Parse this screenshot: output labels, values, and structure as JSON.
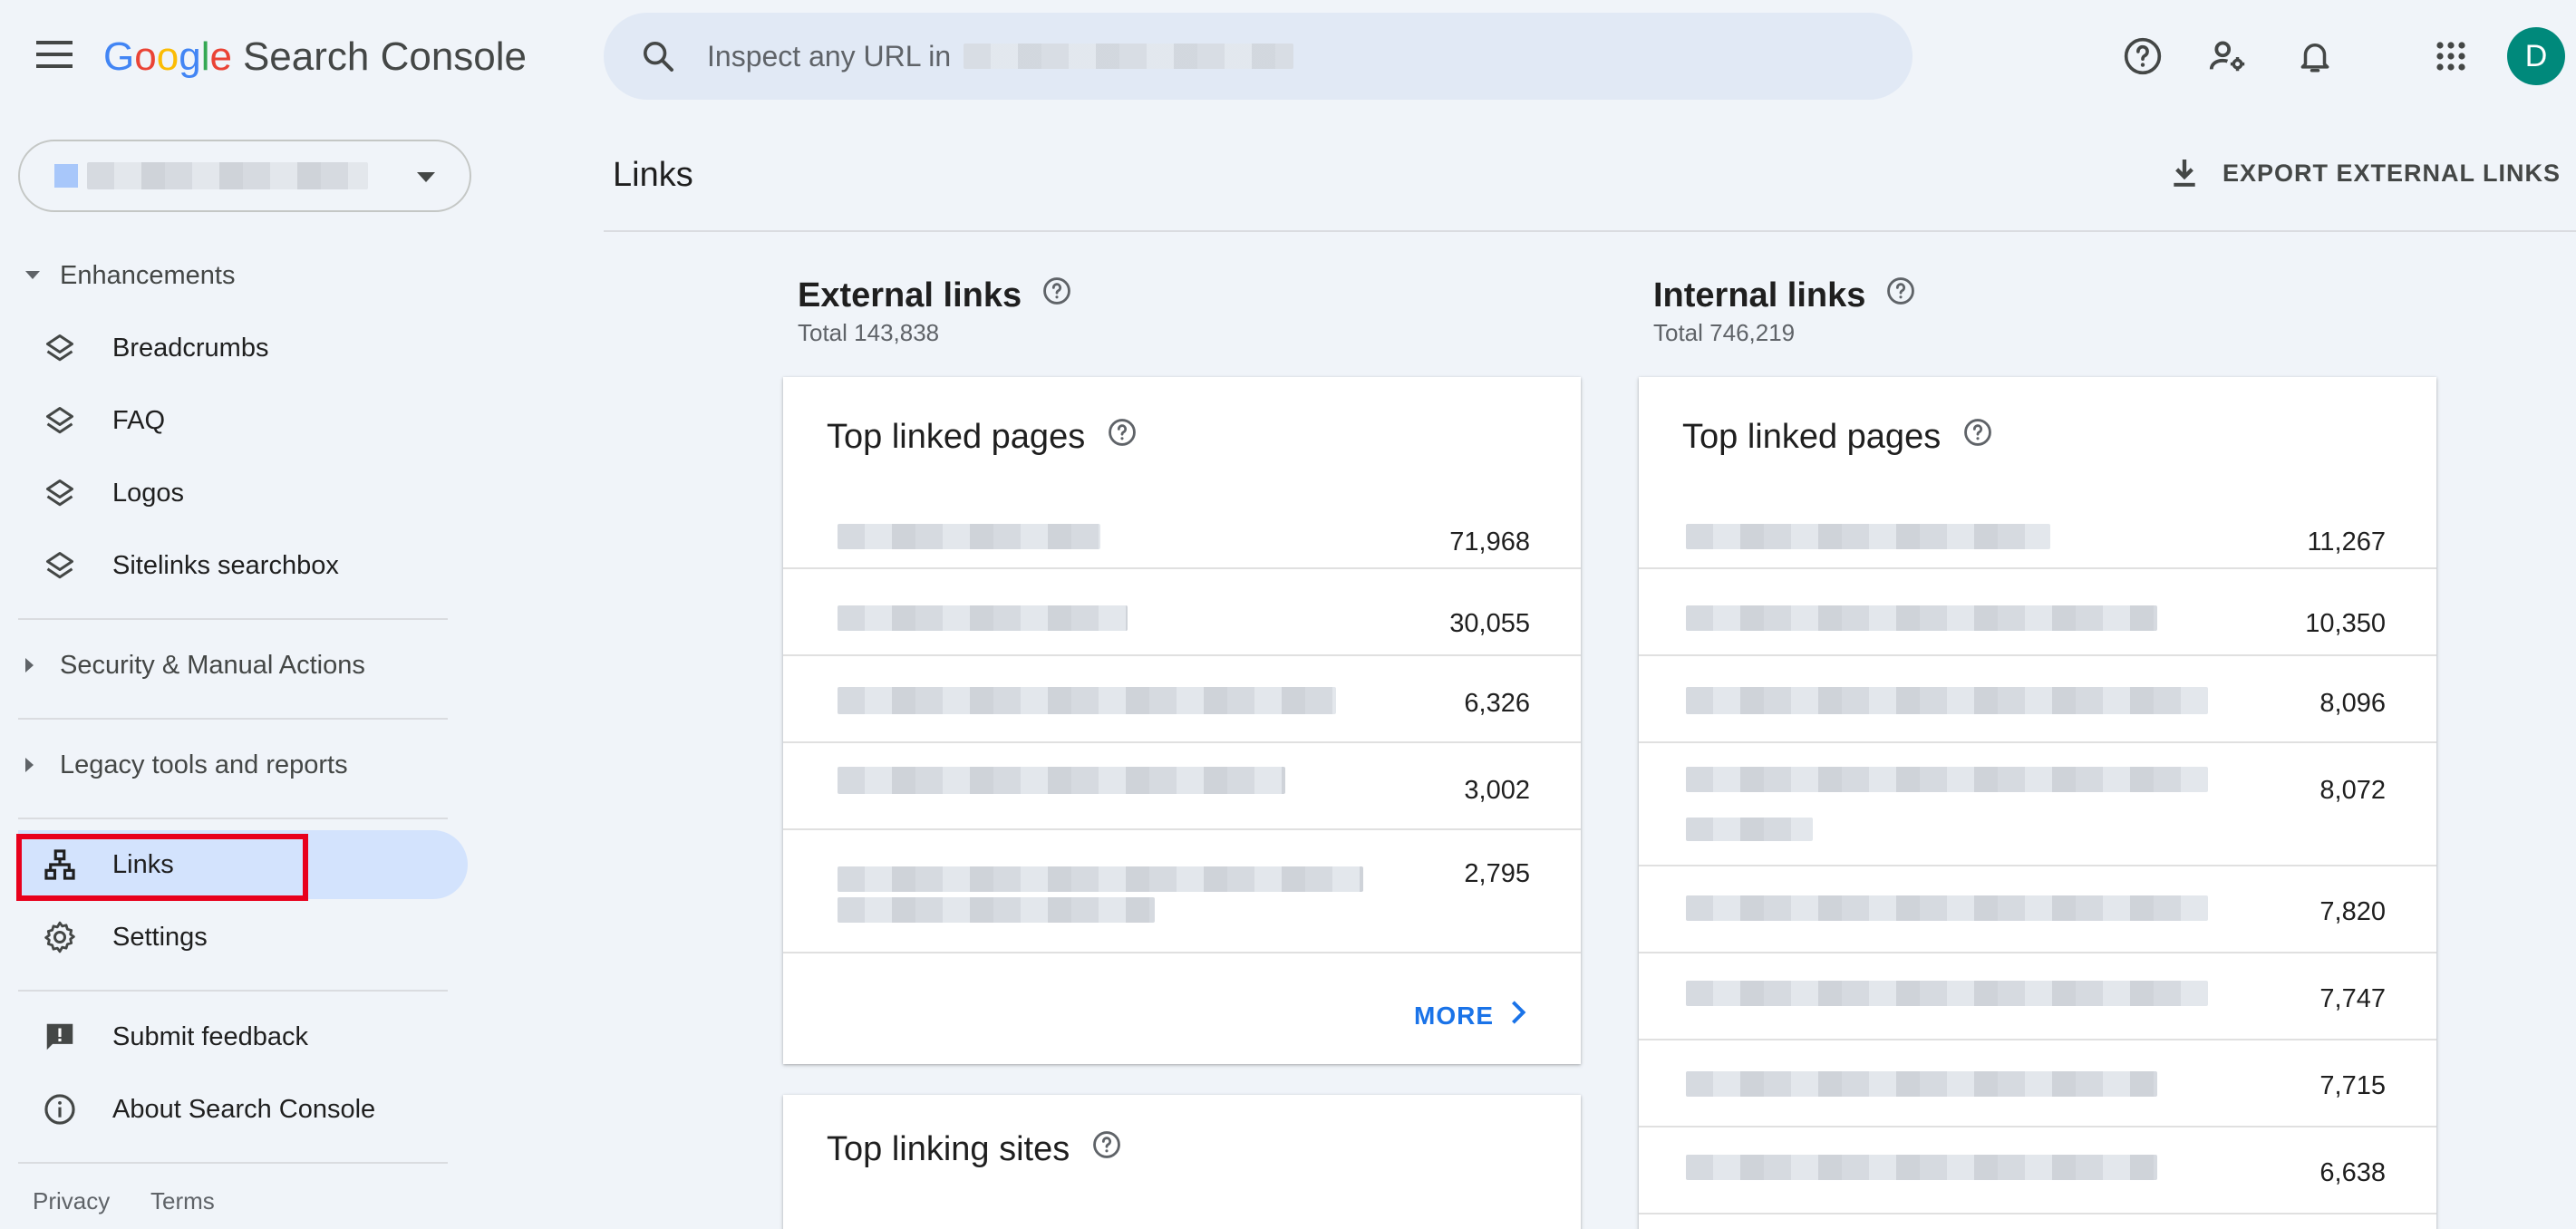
{
  "app": {
    "logo_letters": [
      "G",
      "o",
      "o",
      "g",
      "l",
      "e"
    ],
    "product_name": "Search Console"
  },
  "search": {
    "placeholder": "Inspect any URL in"
  },
  "header": {
    "avatar_letter": "D"
  },
  "sidebar": {
    "section_enhancements": "Enhancements",
    "items_enhancements": [
      {
        "label": "Breadcrumbs"
      },
      {
        "label": "FAQ"
      },
      {
        "label": "Logos"
      },
      {
        "label": "Sitelinks searchbox"
      }
    ],
    "section_security": "Security & Manual Actions",
    "section_legacy": "Legacy tools and reports",
    "links_label": "Links",
    "settings_label": "Settings",
    "feedback_label": "Submit feedback",
    "about_label": "About Search Console",
    "footer_privacy": "Privacy",
    "footer_terms": "Terms"
  },
  "main": {
    "page_title": "Links",
    "export_label": "EXPORT EXTERNAL LINKS",
    "external": {
      "title": "External links",
      "total": "Total 143,838",
      "top_linked_title": "Top linked pages",
      "rows": [
        "71,968",
        "30,055",
        "6,326",
        "3,002",
        "2,795"
      ],
      "more_label": "MORE",
      "top_linking_sites_title": "Top linking sites"
    },
    "internal": {
      "title": "Internal links",
      "total": "Total 746,219",
      "top_linked_title": "Top linked pages",
      "rows": [
        "11,267",
        "10,350",
        "8,096",
        "8,072",
        "7,820",
        "7,747",
        "7,715",
        "6,638"
      ]
    }
  },
  "colors": {
    "accent_blue": "#1a73e8",
    "active_nav_bg": "#d3e3fd",
    "highlight_red": "#e8001c",
    "avatar_bg": "#00897b"
  }
}
